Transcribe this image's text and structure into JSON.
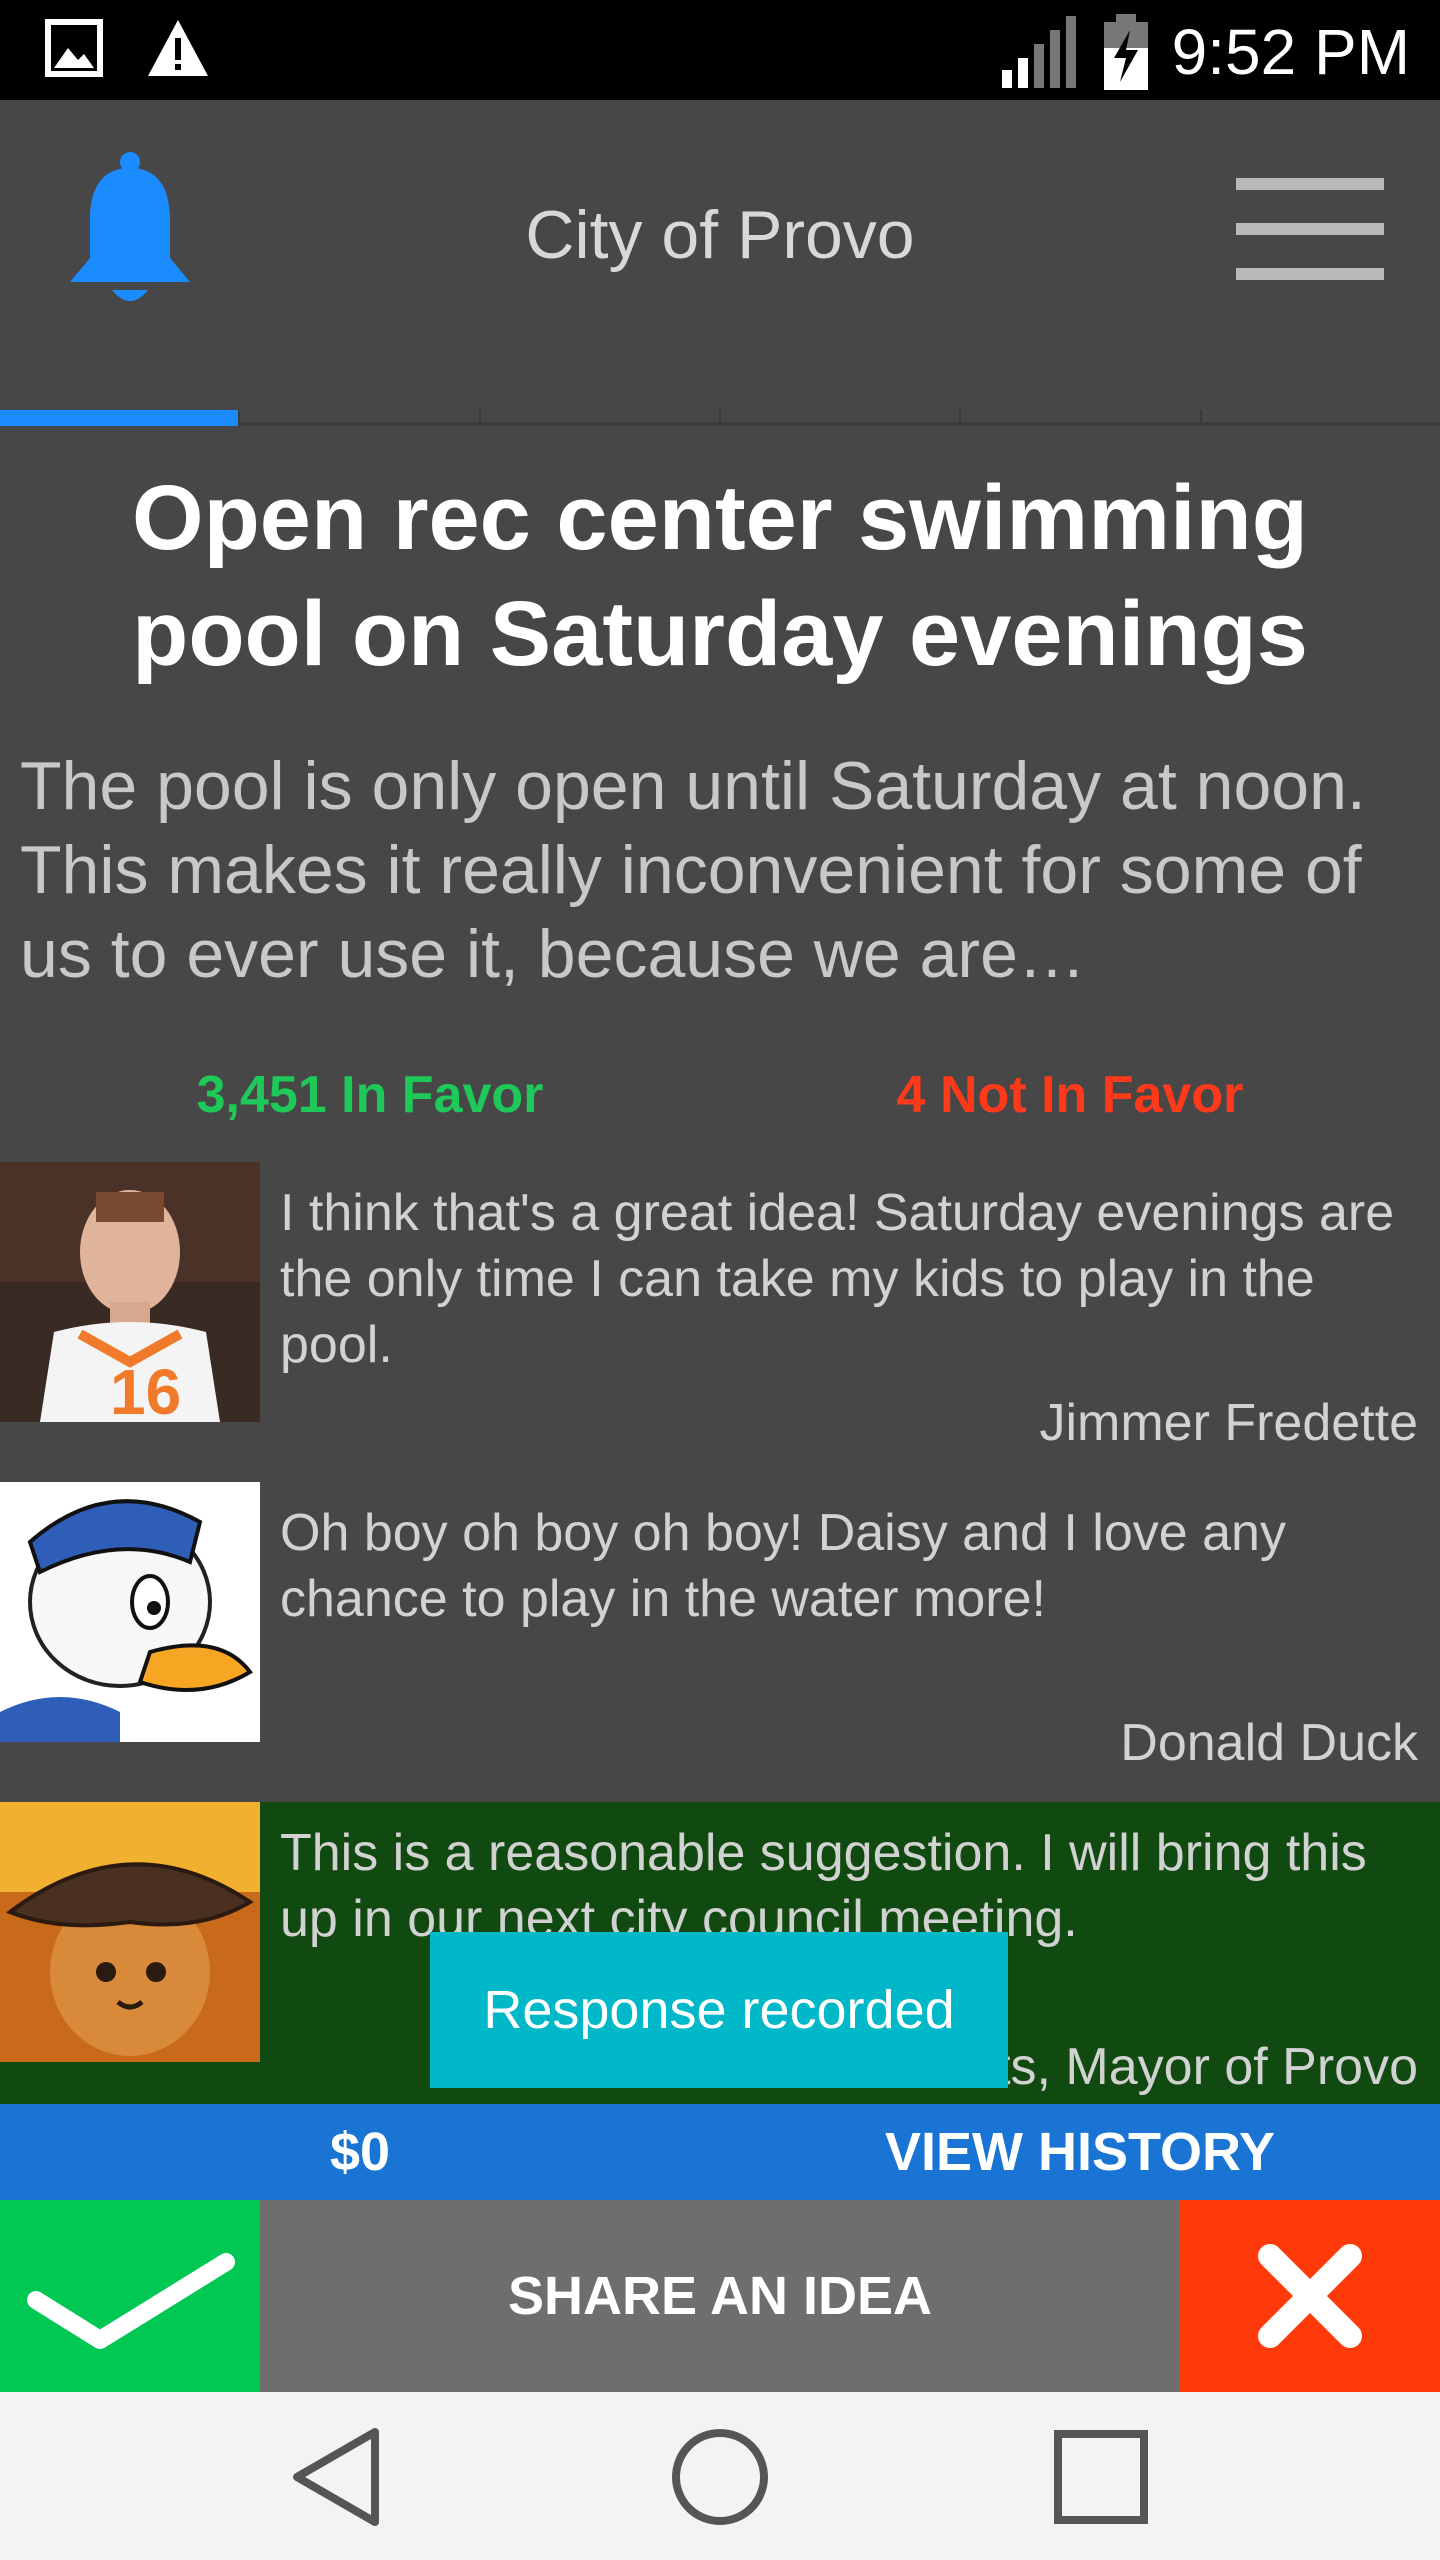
{
  "status_bar": {
    "time": "9:52 PM",
    "icons": [
      "image-notification-icon",
      "warning-icon",
      "signal-icon",
      "battery-charging-icon"
    ]
  },
  "header": {
    "title": "City of Provo",
    "bell_icon": "bell-icon",
    "menu_icon": "hamburger-menu-icon",
    "accent_color": "#1a8cff"
  },
  "idea": {
    "title": "Open rec center swimming pool on Saturday evenings",
    "description": "The pool is only open until Saturday at noon. This makes it really inconvenient for some of us to ever use it, because we are…"
  },
  "votes": {
    "favor": "3,451 In Favor",
    "against": "4 Not In Favor",
    "favor_color": "#1ec95a",
    "against_color": "#ff3a1a"
  },
  "comments": [
    {
      "text": "I think that's a great idea! Saturday evenings are the only time I can take my kids to play in the pool.",
      "author": "Jimmer Fredette"
    },
    {
      "text": "Oh boy oh boy oh boy! Daisy and I love any chance to play in the water more!",
      "author": "Donald Duck"
    },
    {
      "text": "This is a reasonable suggestion. I will bring this up in our next city council meeting.",
      "author": "Puss I. Boots, Mayor of Provo"
    }
  ],
  "toast": "Response recorded",
  "info_bar": {
    "balance": "$0",
    "history": "VIEW HISTORY"
  },
  "action_bar": {
    "share": "SHARE AN IDEA",
    "approve_icon": "checkmark-icon",
    "reject_icon": "x-icon"
  },
  "nav_bar": {
    "icons": [
      "back-icon",
      "home-icon",
      "recents-icon"
    ]
  }
}
